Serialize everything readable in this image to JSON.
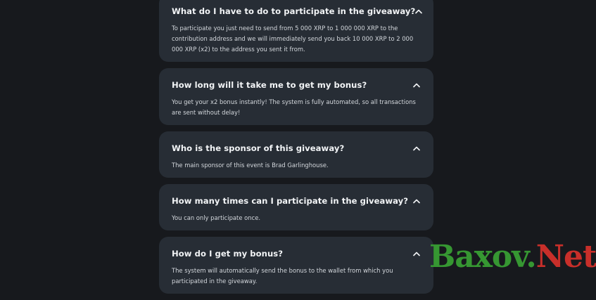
{
  "faq": {
    "items": [
      {
        "question": "What do I have to do to participate in the giveaway?",
        "answer": "To participate you just need to send from 5 000 XRP to 1 000 000 XRP to the contribution address and we will immediately send you back 10 000 XRP to 2 000 000 XRP (x2) to the address you sent it from."
      },
      {
        "question": "How long will it take me to get my bonus?",
        "answer": "You get your x2 bonus instantly! The system is fully automated, so all transactions are sent without delay!"
      },
      {
        "question": "Who is the sponsor of this giveaway?",
        "answer": "The main sponsor of this event is Brad Garlinghouse."
      },
      {
        "question": "How many times can I participate in the giveaway?",
        "answer": "You can only participate once."
      },
      {
        "question": "How do I get my bonus?",
        "answer": "The system will automatically send the bonus to the wallet from which you participated in the giveaway."
      }
    ],
    "toggle_icon": "chevron-up-icon"
  },
  "watermark": {
    "part1": "Baxov.",
    "part2": "Net",
    "colors": {
      "part1": "#39a234",
      "part2": "#d7312c"
    }
  },
  "colors": {
    "background": "#17191d",
    "card": "#272d35",
    "question_text": "#f2f4f6",
    "answer_text": "#d3d7dc"
  }
}
